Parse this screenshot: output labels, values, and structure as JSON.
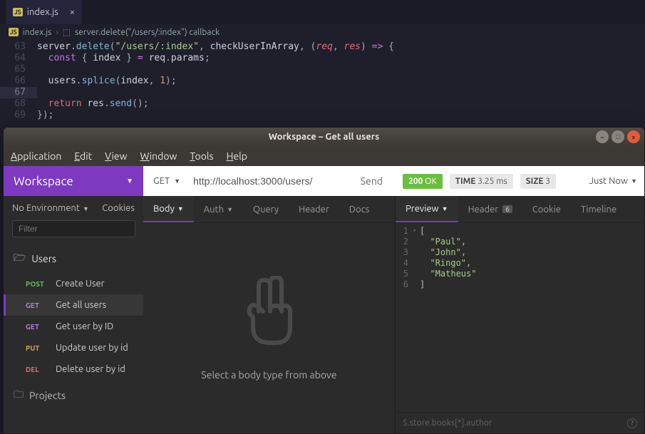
{
  "editor": {
    "tab": {
      "badge": "JS",
      "filename": "index.js"
    },
    "breadcrumb": {
      "badge": "JS",
      "file": "index.js",
      "symbol": "server.delete(\"/users/:index\") callback"
    },
    "lines": [
      {
        "n": 63,
        "tokens": [
          [
            "id",
            "server"
          ],
          [
            "pun",
            "."
          ],
          [
            "fn",
            "delete"
          ],
          [
            "pun",
            "("
          ],
          [
            "str",
            "\"/users/:index\""
          ],
          [
            "pun",
            ", "
          ],
          [
            "id",
            "checkUserInArray"
          ],
          [
            "pun",
            ", ("
          ],
          [
            "arg",
            "req"
          ],
          [
            "pun",
            ", "
          ],
          [
            "arg",
            "res"
          ],
          [
            "pun",
            ") "
          ],
          [
            "kw",
            "=>"
          ],
          [
            "pun",
            " {"
          ]
        ]
      },
      {
        "n": 64,
        "tokens": [
          [
            "pun",
            "  "
          ],
          [
            "kw",
            "const"
          ],
          [
            "pun",
            " { "
          ],
          [
            "id",
            "index"
          ],
          [
            "pun",
            " } "
          ],
          [
            "kw",
            "="
          ],
          [
            "pun",
            " "
          ],
          [
            "id",
            "req"
          ],
          [
            "pun",
            "."
          ],
          [
            "id",
            "params"
          ],
          [
            "pun",
            ";"
          ]
        ]
      },
      {
        "n": 65,
        "tokens": []
      },
      {
        "n": 66,
        "tokens": [
          [
            "pun",
            "  "
          ],
          [
            "id",
            "users"
          ],
          [
            "pun",
            "."
          ],
          [
            "fn",
            "splice"
          ],
          [
            "pun",
            "("
          ],
          [
            "id",
            "index"
          ],
          [
            "pun",
            ", "
          ],
          [
            "num",
            "1"
          ],
          [
            "pun",
            ");"
          ]
        ]
      },
      {
        "n": 67,
        "tokens": [],
        "hl": true
      },
      {
        "n": 68,
        "tokens": [
          [
            "pun",
            "  "
          ],
          [
            "kw2",
            "return"
          ],
          [
            "pun",
            " "
          ],
          [
            "id",
            "res"
          ],
          [
            "pun",
            "."
          ],
          [
            "fn",
            "send"
          ],
          [
            "pun",
            "();"
          ]
        ]
      },
      {
        "n": 69,
        "tokens": [
          [
            "pun",
            "});"
          ]
        ]
      }
    ]
  },
  "window": {
    "title": "Workspace – Get all users",
    "menus": [
      "Application",
      "Edit",
      "View",
      "Window",
      "Tools",
      "Help"
    ]
  },
  "workspace": {
    "label": "Workspace"
  },
  "sidebar": {
    "env": "No Environment",
    "cookies": "Cookies",
    "filter_placeholder": "Filter",
    "folder": "Users",
    "requests": [
      {
        "method": "POST",
        "cls": "m-post",
        "name": "Create User"
      },
      {
        "method": "GET",
        "cls": "m-get",
        "name": "Get all users",
        "selected": true
      },
      {
        "method": "GET",
        "cls": "m-get",
        "name": "Get user by ID"
      },
      {
        "method": "PUT",
        "cls": "m-put",
        "name": "Update user by id"
      },
      {
        "method": "DEL",
        "cls": "m-del",
        "name": "Delete user by id"
      }
    ],
    "projects": "Projects"
  },
  "request": {
    "method": "GET",
    "url": "http://localhost:3000/users/",
    "send": "Send"
  },
  "response": {
    "status": {
      "code": "200",
      "text": "OK"
    },
    "time": {
      "label": "TIME",
      "value": "3.25 ms"
    },
    "size": {
      "label": "SIZE",
      "value": "3"
    },
    "age": "Just Now"
  },
  "left_tabs": [
    "Body",
    "Auth",
    "Query",
    "Header",
    "Docs"
  ],
  "left_active": "Body",
  "body_empty": "Select a body type from above",
  "right_tabs": [
    {
      "label": "Preview",
      "active": true,
      "caret": true
    },
    {
      "label": "Header",
      "badge": "6"
    },
    {
      "label": "Cookie"
    },
    {
      "label": "Timeline"
    }
  ],
  "json_lines": [
    {
      "n": 1,
      "fold": "▾",
      "text": "[",
      "type": "pun"
    },
    {
      "n": 2,
      "indent": "  ",
      "val": "\"Paul\"",
      "trail": ","
    },
    {
      "n": 3,
      "indent": "  ",
      "val": "\"John\"",
      "trail": ","
    },
    {
      "n": 4,
      "indent": "  ",
      "val": "\"Ringo\"",
      "trail": ","
    },
    {
      "n": 5,
      "indent": "  ",
      "val": "\"Matheus\"",
      "trail": ""
    },
    {
      "n": 6,
      "text": "]",
      "type": "pun"
    }
  ],
  "jsonpath_placeholder": "$.store.books[*].author"
}
